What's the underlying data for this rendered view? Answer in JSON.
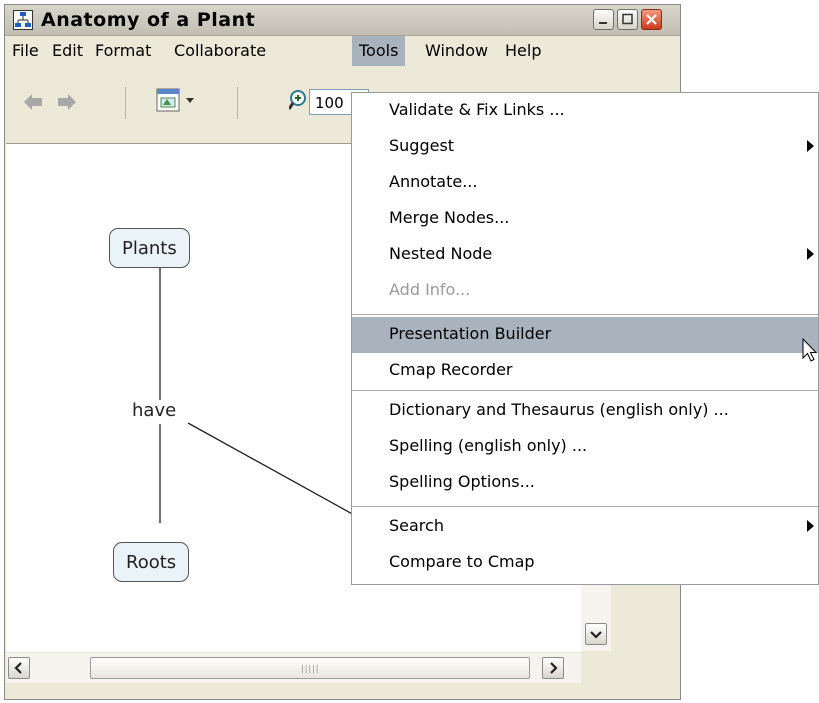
{
  "window": {
    "title": "Anatomy of a Plant"
  },
  "menubar": [
    "File",
    "Edit",
    "Format",
    "Collaborate",
    "Tools",
    "Window",
    "Help"
  ],
  "toolbar": {
    "zoom_value": "100"
  },
  "map": {
    "nodes": {
      "plants": "Plants",
      "roots": "Roots"
    },
    "linking_phrase": "have"
  },
  "tools_menu": {
    "items": [
      {
        "label": "Validate & Fix Links ...",
        "submenu": false,
        "disabled": false
      },
      {
        "label": "Suggest",
        "submenu": true,
        "disabled": false
      },
      {
        "label": "Annotate...",
        "submenu": false,
        "disabled": false
      },
      {
        "label": "Merge Nodes...",
        "submenu": false,
        "disabled": false
      },
      {
        "label": "Nested Node",
        "submenu": true,
        "disabled": false
      },
      {
        "label": "Add Info...",
        "submenu": false,
        "disabled": true
      },
      {
        "label": "Presentation Builder",
        "submenu": false,
        "disabled": false,
        "highlighted": true
      },
      {
        "label": "Cmap Recorder",
        "submenu": false,
        "disabled": false
      },
      {
        "label": "Dictionary and Thesaurus (english only) ...",
        "submenu": false,
        "disabled": false
      },
      {
        "label": "Spelling (english only) ...",
        "submenu": false,
        "disabled": false
      },
      {
        "label": "Spelling Options...",
        "submenu": false,
        "disabled": false
      },
      {
        "label": "Search",
        "submenu": true,
        "disabled": false
      },
      {
        "label": "Compare to Cmap",
        "submenu": false,
        "disabled": false
      }
    ]
  },
  "colors": {
    "highlight": "#a9b3be",
    "window_bg": "#ece9d8",
    "node_fill": "#eaf3f7"
  }
}
